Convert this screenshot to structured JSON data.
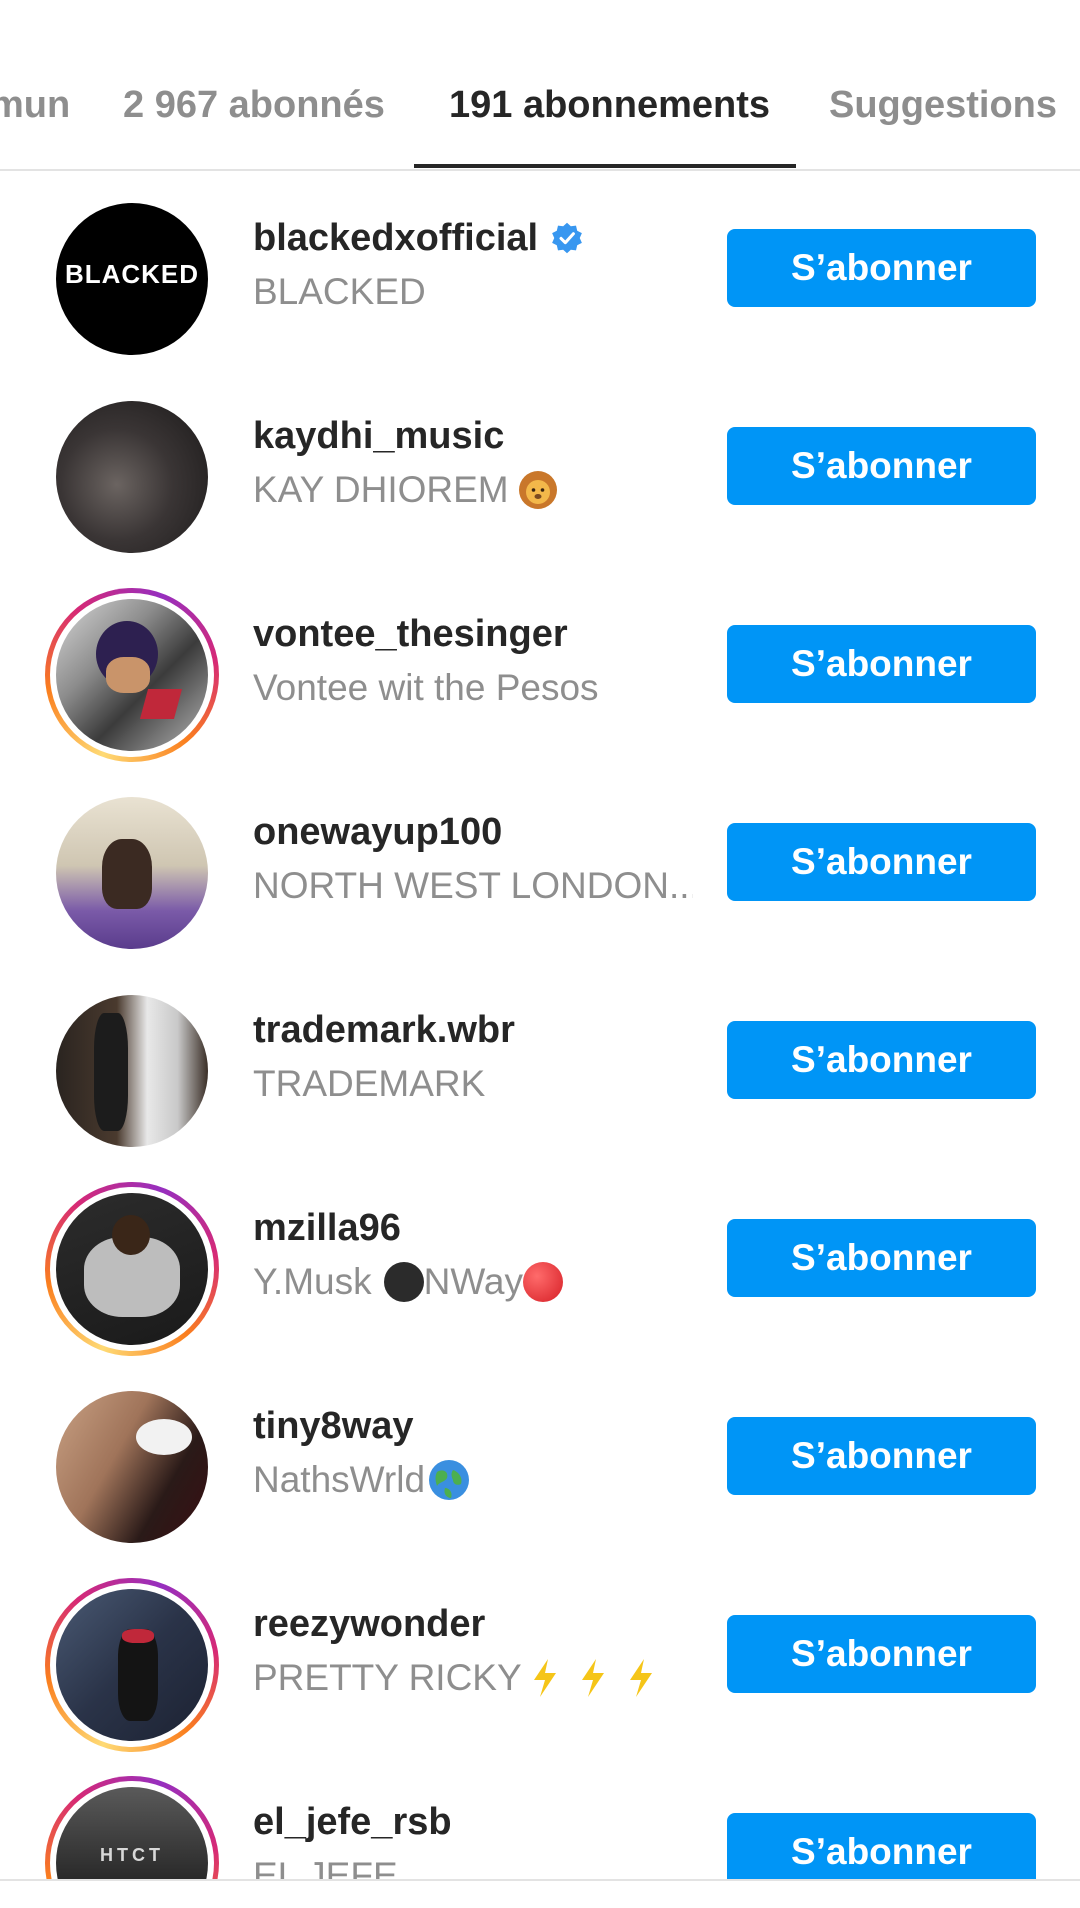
{
  "tabs": {
    "partial": "mun",
    "followers": "2 967 abonnés",
    "following": "191 abonnements",
    "suggestions": "Suggestions"
  },
  "follow_label": "S’abonner",
  "accounts": [
    {
      "username": "blackedxofficial",
      "fullname": "BLACKED",
      "verified": true,
      "story_ring": false,
      "avatar_text": "BLACKED",
      "emoji": ""
    },
    {
      "username": "kaydhi_music",
      "fullname": "KAY DHIOREM",
      "verified": false,
      "story_ring": false,
      "avatar_text": "",
      "emoji": "lion-emoji"
    },
    {
      "username": "vontee_thesinger",
      "fullname": "Vontee wit the Pesos",
      "verified": false,
      "story_ring": true,
      "avatar_text": "",
      "emoji": ""
    },
    {
      "username": "onewayup100",
      "fullname": "NORTH WEST LONDON...",
      "verified": false,
      "story_ring": false,
      "avatar_text": "",
      "emoji": ""
    },
    {
      "username": "trademark.wbr",
      "fullname": "TRADEMARK",
      "verified": false,
      "story_ring": false,
      "avatar_text": "",
      "emoji": ""
    },
    {
      "username": "mzilla96",
      "fullname": "Y.Musk",
      "fullname_mid": "NWay",
      "verified": false,
      "story_ring": true,
      "avatar_text": "",
      "emoji": "black-circle-red-circle"
    },
    {
      "username": "tiny8way",
      "fullname": "NathsWrld",
      "verified": false,
      "story_ring": false,
      "avatar_text": "",
      "emoji": "globe-emoji"
    },
    {
      "username": "reezywonder",
      "fullname": "PRETTY RICKY",
      "verified": false,
      "story_ring": true,
      "avatar_text": "",
      "emoji": "lightning-emojis"
    },
    {
      "username": "el_jefe_rsb",
      "fullname": "EL JEFE",
      "verified": false,
      "story_ring": true,
      "avatar_text": "HTCT",
      "emoji": ""
    }
  ],
  "colors": {
    "accent": "#0095f6",
    "text_primary": "#262626",
    "text_secondary": "#8e8e8e"
  }
}
